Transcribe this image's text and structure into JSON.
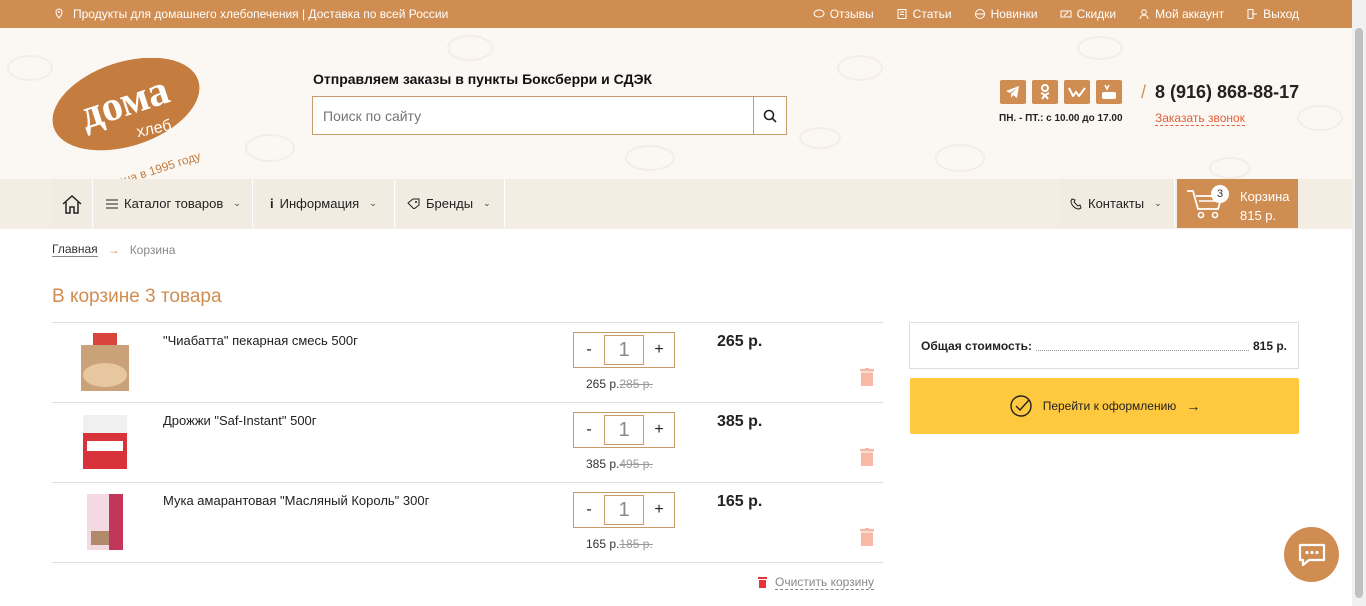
{
  "topbar": {
    "tagline": "Продукты для домашнего хлебопечения | Доставка по всей России",
    "links": [
      {
        "label": "Отзывы",
        "icon": "chat-icon"
      },
      {
        "label": "Статьи",
        "icon": "article-icon"
      },
      {
        "label": "Новинки",
        "icon": "new-icon"
      },
      {
        "label": "Скидки",
        "icon": "discount-icon"
      },
      {
        "label": "Мой аккаунт",
        "icon": "user-icon"
      },
      {
        "label": "Выход",
        "icon": "logout-icon"
      }
    ]
  },
  "logo": {
    "main": "дома",
    "sub": "хлеб",
    "slogan": "основана в 1995 году"
  },
  "header": {
    "shipping": "Отправляем заказы в пункты Боксберри и СДЭК",
    "search_placeholder": "Поиск по сайту",
    "socials": [
      "telegram-icon",
      "odnoklassniki-icon",
      "vk-icon",
      "youtube-icon"
    ],
    "hours": "ПН. - ПТ.: с 10.00 до 17.00",
    "phone": "8 (916) 868-88-17",
    "callback": "Заказать звонок"
  },
  "nav": {
    "catalog": "Каталог товаров",
    "info": "Информация",
    "brands": "Бренды",
    "contacts": "Контакты",
    "cart_count": "3",
    "cart_label": "Корзина",
    "cart_sum": "815 р."
  },
  "breadcrumb": {
    "home": "Главная",
    "current": "Корзина"
  },
  "page_title": "В корзине 3 товара",
  "items": [
    {
      "name": "\"Чиабатта\" пекарная смесь 500г",
      "qty": "1",
      "price": "265 р.",
      "old_price": "285 р.",
      "total": "265 р."
    },
    {
      "name": "Дрожжи \"Saf-Instant\" 500г",
      "qty": "1",
      "price": "385 р.",
      "old_price": "495 р.",
      "total": "385 р."
    },
    {
      "name": "Мука амарантовая \"Масляный Король\"  300г",
      "qty": "1",
      "price": "165 р.",
      "old_price": "185 р.",
      "total": "165 р."
    }
  ],
  "qty_minus": "-",
  "qty_plus": "+",
  "clear_cart": "Очистить корзину",
  "summary": {
    "label": "Общая стоимость:",
    "value": "815 р."
  },
  "checkout": "Перейти к оформлению",
  "colors": {
    "accent": "#d08d51",
    "checkout": "#fec83f",
    "danger": "#f07b5a"
  }
}
